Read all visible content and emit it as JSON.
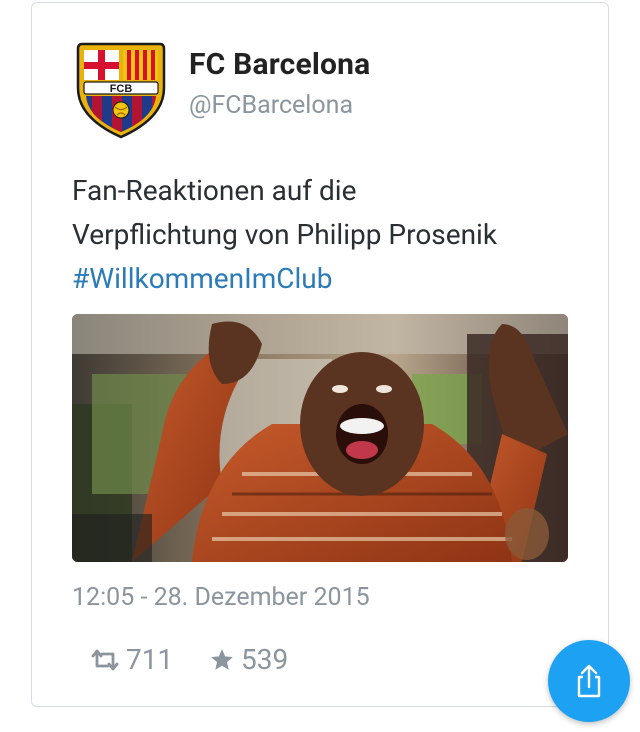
{
  "tweet": {
    "author": {
      "name": "FC Barcelona",
      "handle": "@FCBarcelona",
      "avatar_text": "FCB"
    },
    "text_line1": "Fan-Reaktionen auf die",
    "text_line2": "Verpflichtung von Philipp Prosenik",
    "hashtag": "#WillkommenImClub",
    "timestamp": "12:05 - 28. Dezember 2015",
    "stats": {
      "retweets": "711",
      "likes": "539"
    }
  },
  "icons": {
    "retweet": "retweet-icon",
    "like": "star-icon",
    "share": "share-icon"
  },
  "colors": {
    "hashtag": "#2b7bb9",
    "share_button": "#1da1f2",
    "muted_text": "#8a959e"
  }
}
